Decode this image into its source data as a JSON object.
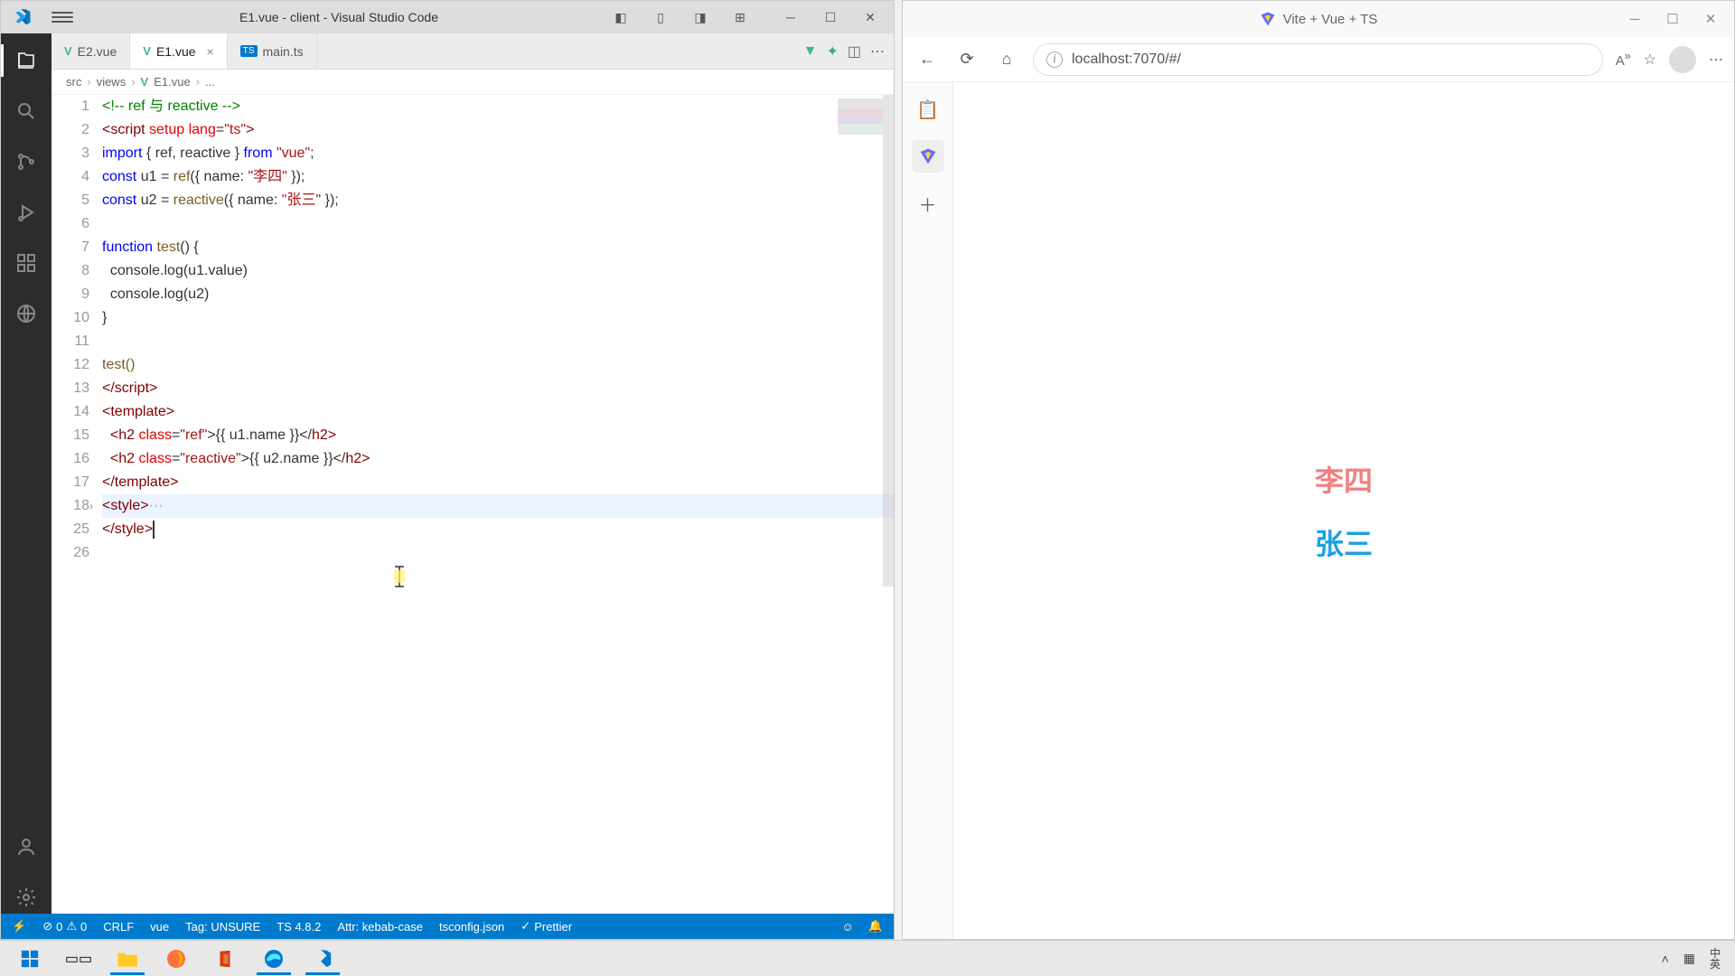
{
  "vscode": {
    "title": "E1.vue - client - Visual Studio Code",
    "tabs": [
      {
        "label": "E2.vue",
        "kind": "vue",
        "active": false
      },
      {
        "label": "E1.vue",
        "kind": "vue",
        "active": true
      },
      {
        "label": "main.ts",
        "kind": "ts",
        "active": false
      }
    ],
    "breadcrumb": [
      "src",
      "views",
      "E1.vue",
      "..."
    ],
    "line_numbers": [
      "1",
      "2",
      "3",
      "4",
      "5",
      "6",
      "7",
      "8",
      "9",
      "10",
      "11",
      "12",
      "13",
      "14",
      "15",
      "16",
      "17",
      "18",
      "25",
      "26"
    ],
    "code": {
      "l1_a": "<!-- ",
      "l1_b": "ref 与 reactive",
      "l1_c": " -->",
      "l2_a": "<script ",
      "l2_b": "setup lang",
      "l2_c": "=",
      "l2_d": "\"ts\"",
      "l2_e": ">",
      "l3_a": "import",
      "l3_b": " { ref, reactive } ",
      "l3_c": "from",
      "l3_d": " \"vue\"",
      "l3_e": ";",
      "l4_a": "const",
      "l4_b": " u1 = ",
      "l4_c": "ref",
      "l4_d": "({ name: ",
      "l4_e": "\"李四\"",
      "l4_f": " });",
      "l5_a": "const",
      "l5_b": " u2 = ",
      "l5_c": "reactive",
      "l5_d": "({ name: ",
      "l5_e": "\"张三\"",
      "l5_f": " });",
      "l7_a": "function",
      "l7_b": " ",
      "l7_c": "test",
      "l7_d": "() {",
      "l8": "  console.log(u1.value)",
      "l9": "  console.log(u2)",
      "l10": "}",
      "l12": "test()",
      "l13_a": "</",
      "l13_b": "script",
      "l13_c": ">",
      "l14_a": "<",
      "l14_b": "template",
      "l14_c": ">",
      "l15_a": "  <",
      "l15_b": "h2 ",
      "l15_c": "class",
      "l15_d": "=",
      "l15_e": "\"ref\"",
      "l15_f": ">{{ u1.name }}</",
      "l15_g": "h2",
      "l15_h": ">",
      "l16_a": "  <",
      "l16_b": "h2 ",
      "l16_c": "class",
      "l16_d": "=",
      "l16_e": "\"reactive\"",
      "l16_f": ">{{ u2.name }}</",
      "l16_g": "h2",
      "l16_h": ">",
      "l17_a": "</",
      "l17_b": "template",
      "l17_c": ">",
      "l18_a": "<",
      "l18_b": "style",
      "l18_c": ">",
      "l18_d": "···",
      "l25_a": "</",
      "l25_b": "style",
      "l25_c": ">"
    },
    "statusbar": {
      "errors": "0",
      "warnings": "0",
      "crlf": "CRLF",
      "lang": "vue",
      "tag": "Tag: UNSURE",
      "ts": "TS 4.8.2",
      "attr": "Attr: kebab-case",
      "tsconfig": "tsconfig.json",
      "prettier": "Prettier"
    }
  },
  "browser": {
    "title": "Vite + Vue + TS",
    "url": "localhost:7070/#/",
    "aa_label": "A",
    "content": {
      "ref_text": "李四",
      "reactive_text": "张三"
    }
  },
  "taskbar": {
    "ime_top": "中",
    "ime_bot": "英"
  }
}
